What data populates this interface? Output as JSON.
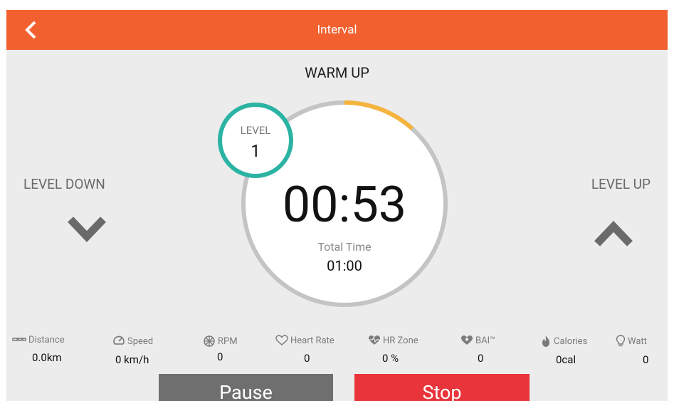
{
  "header": {
    "title": "Interval"
  },
  "workout": {
    "phase": "WARM UP",
    "level_label": "LEVEL",
    "level_value": "1",
    "timer": "00:53",
    "total_label": "Total Time",
    "total_value": "01:00",
    "progress": 0.117
  },
  "controls": {
    "level_down": "LEVEL DOWN",
    "level_up": "LEVEL UP",
    "pause": "Pause",
    "stop": "Stop"
  },
  "stats": [
    {
      "label": "Distance",
      "value": "0.0km",
      "icon": "distance-icon"
    },
    {
      "label": "Speed",
      "value": "0 km/h",
      "icon": "speed-icon"
    },
    {
      "label": "RPM",
      "value": "0",
      "icon": "rpm-icon"
    },
    {
      "label": "Heart Rate",
      "value": "0",
      "icon": "heart-icon"
    },
    {
      "label": "HR Zone",
      "value": "0 %",
      "icon": "hr-zone-icon"
    },
    {
      "label": "BAI™",
      "value": "0",
      "icon": "bai-icon"
    },
    {
      "label": "Calories",
      "value": "0cal",
      "icon": "calories-icon"
    },
    {
      "label": "Watt",
      "value": "0",
      "icon": "watt-icon"
    }
  ],
  "colors": {
    "header": "#f2602f",
    "background": "#ececec",
    "ring_track": "#c4c4c4",
    "ring_progress": "#f5b43c",
    "level_ring": "#2bb3a3",
    "pause_button": "#6f6f6f",
    "stop_button": "#e8343a"
  }
}
